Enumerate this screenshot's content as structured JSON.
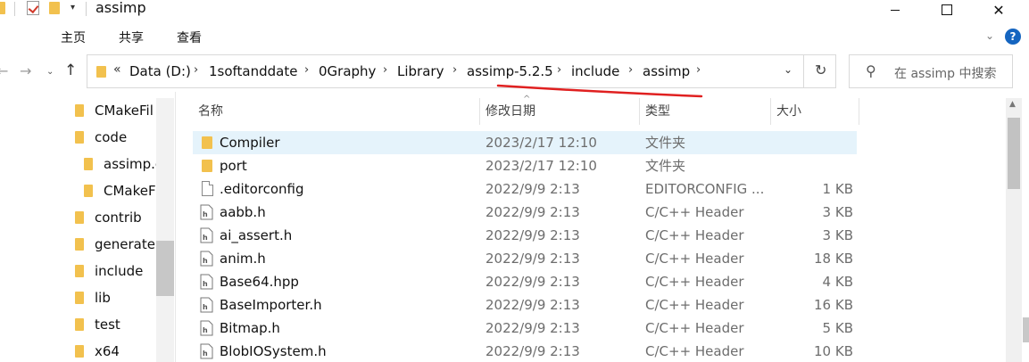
{
  "window": {
    "title": "assimp"
  },
  "ribbon": {
    "tabs": [
      "主页",
      "共享",
      "查看"
    ]
  },
  "address": {
    "more": "«",
    "crumbs": [
      "Data (D:)",
      "1softanddate",
      "0Graphy",
      "Library",
      "assimp-5.2.5",
      "include",
      "assimp"
    ],
    "separator": "›"
  },
  "search": {
    "placeholder": "在 assimp 中搜索"
  },
  "nav_tree": [
    {
      "label": "CMakeFil"
    },
    {
      "label": "code"
    },
    {
      "label": "assimp.c"
    },
    {
      "label": "CMakeF"
    },
    {
      "label": "contrib"
    },
    {
      "label": "generate"
    },
    {
      "label": "include"
    },
    {
      "label": "lib"
    },
    {
      "label": "test"
    },
    {
      "label": "x64"
    }
  ],
  "columns": {
    "name": "名称",
    "date": "修改日期",
    "type": "类型",
    "size": "大小"
  },
  "files": [
    {
      "name": "Compiler",
      "date": "2023/2/17 12:10",
      "type": "文件夹",
      "size": "",
      "icon": "folder-icon"
    },
    {
      "name": "port",
      "date": "2023/2/17 12:10",
      "type": "文件夹",
      "size": "",
      "icon": "folder-icon"
    },
    {
      "name": ".editorconfig",
      "date": "2022/9/9 2:13",
      "type": "EDITORCONFIG ...",
      "size": "1 KB",
      "icon": "file-icon"
    },
    {
      "name": "aabb.h",
      "date": "2022/9/9 2:13",
      "type": "C/C++ Header",
      "size": "3 KB",
      "icon": "header-file-icon"
    },
    {
      "name": "ai_assert.h",
      "date": "2022/9/9 2:13",
      "type": "C/C++ Header",
      "size": "3 KB",
      "icon": "header-file-icon"
    },
    {
      "name": "anim.h",
      "date": "2022/9/9 2:13",
      "type": "C/C++ Header",
      "size": "18 KB",
      "icon": "header-file-icon"
    },
    {
      "name": "Base64.hpp",
      "date": "2022/9/9 2:13",
      "type": "C/C++ Header",
      "size": "4 KB",
      "icon": "header-file-icon"
    },
    {
      "name": "BaseImporter.h",
      "date": "2022/9/9 2:13",
      "type": "C/C++ Header",
      "size": "16 KB",
      "icon": "header-file-icon"
    },
    {
      "name": "Bitmap.h",
      "date": "2022/9/9 2:13",
      "type": "C/C++ Header",
      "size": "5 KB",
      "icon": "header-file-icon"
    },
    {
      "name": "BlobIOSystem.h",
      "date": "2022/9/9 2:13",
      "type": "C/C++ Header",
      "size": "10 KB",
      "icon": "header-file-icon"
    }
  ],
  "colors": {
    "folder": "#f2c14e",
    "selection": "#e5f3fb",
    "annotation": "#e02020",
    "accent": "#1565c0"
  }
}
